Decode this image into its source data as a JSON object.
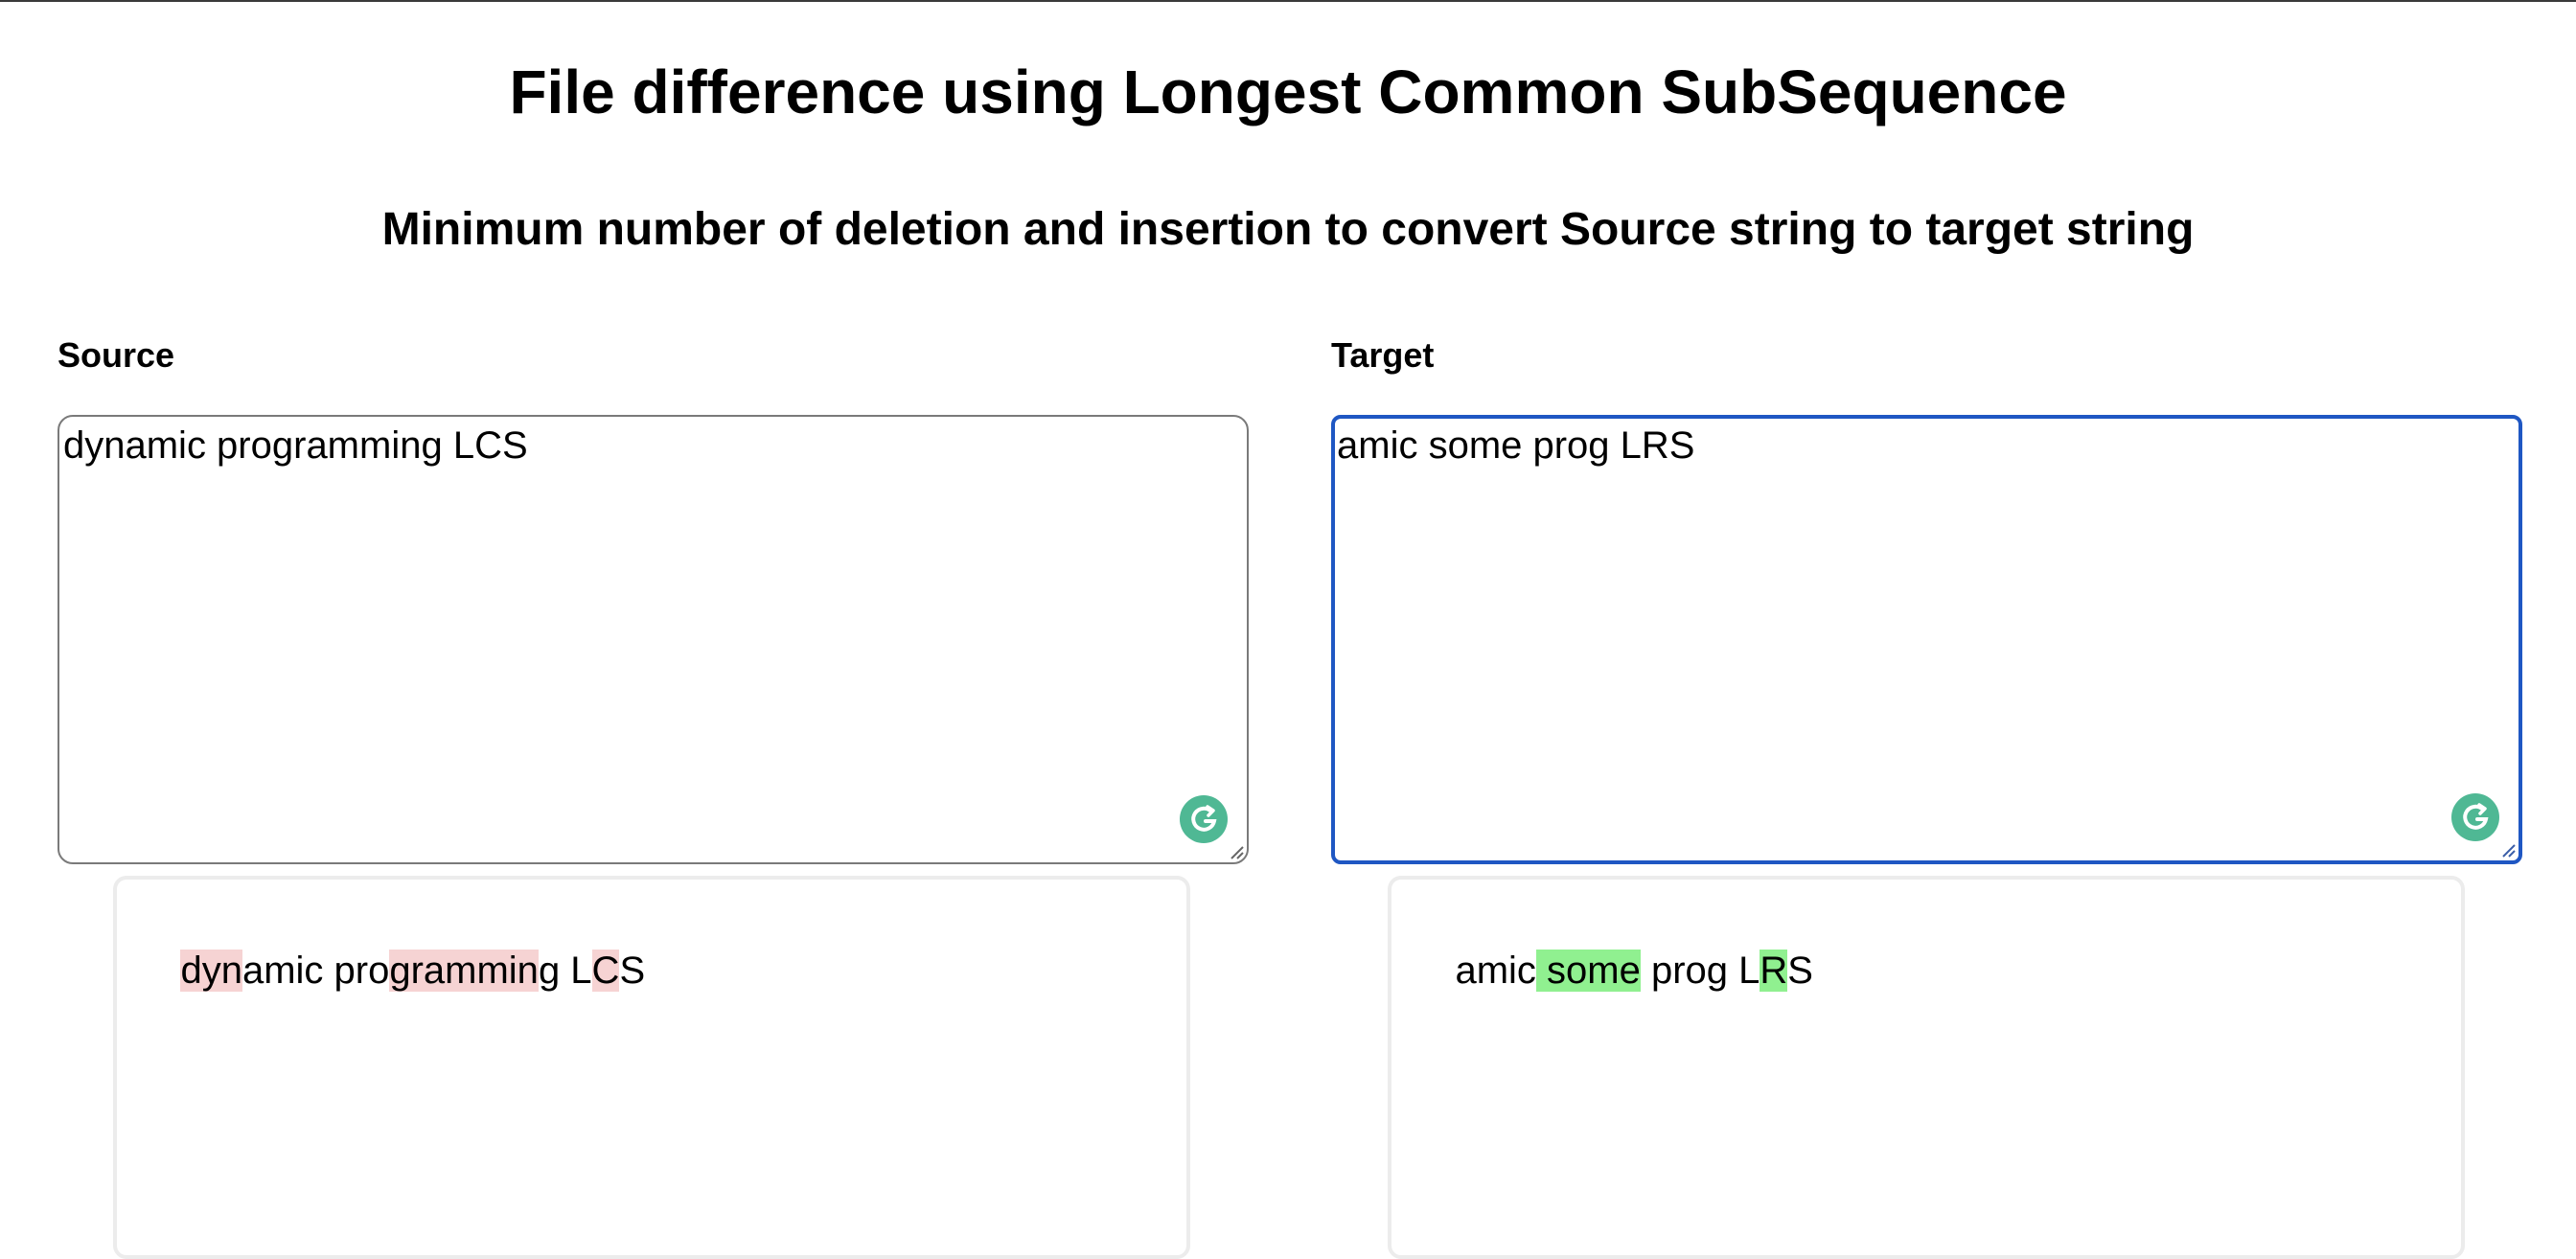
{
  "page": {
    "title": "File difference using Longest Common SubSequence",
    "subtitle": "Minimum number of deletion and insertion to convert Source string to target string"
  },
  "source": {
    "label": "Source",
    "value": "dynamic programming LCS"
  },
  "target": {
    "label": "Target",
    "value": "amic some prog LRS"
  },
  "source_diff": {
    "segments": [
      {
        "text": "dyn",
        "type": "deleted"
      },
      {
        "text": "amic pro",
        "type": "common"
      },
      {
        "text": "grammin",
        "type": "deleted"
      },
      {
        "text": "g L",
        "type": "common"
      },
      {
        "text": "C",
        "type": "deleted"
      },
      {
        "text": "S",
        "type": "common"
      }
    ]
  },
  "target_diff": {
    "segments": [
      {
        "text": "amic",
        "type": "common"
      },
      {
        "text": " some",
        "type": "inserted"
      },
      {
        "text": " prog L",
        "type": "common"
      },
      {
        "text": "R",
        "type": "inserted"
      },
      {
        "text": "S",
        "type": "common"
      }
    ]
  },
  "colors": {
    "deleted": "#f6d3d3",
    "inserted": "#90f090",
    "focus_border": "#1f57c3",
    "grammarly": "#4fb894"
  },
  "icons": {
    "grammarly": "grammarly-icon",
    "resize": "resize-handle-icon"
  }
}
